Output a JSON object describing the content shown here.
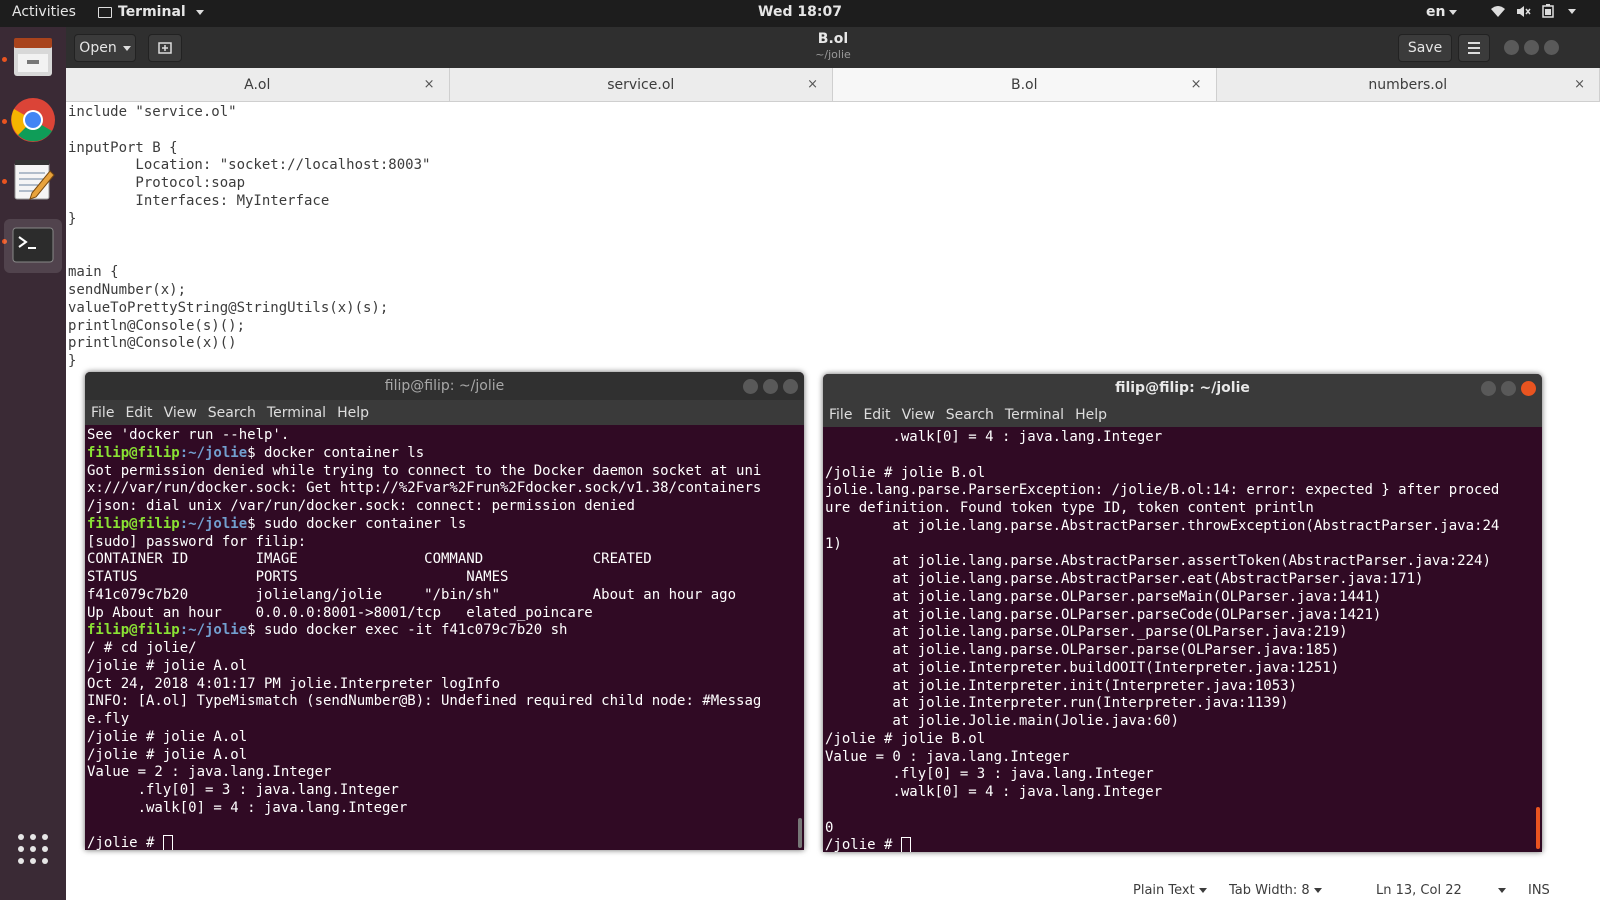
{
  "topbar": {
    "activities": "Activities",
    "app_name": "Terminal",
    "clock": "Wed 18:07",
    "lang": "en"
  },
  "dock": {
    "items": [
      {
        "name": "files",
        "color": "#e6e6e6"
      },
      {
        "name": "chrome",
        "color": "#4285f4"
      },
      {
        "name": "text-editor",
        "color": "#f5f5f5"
      },
      {
        "name": "terminal",
        "color": "#2c2c2c"
      }
    ]
  },
  "gedit": {
    "open_label": "Open",
    "title": "B.ol",
    "subtitle": "~/jolie",
    "save_label": "Save",
    "tabs": [
      {
        "label": "A.ol",
        "close": "×"
      },
      {
        "label": "service.ol",
        "close": "×"
      },
      {
        "label": "B.ol",
        "close": "×"
      },
      {
        "label": "numbers.ol",
        "close": "×"
      }
    ],
    "editor_lines": [
      "include \"service.ol\"",
      "",
      "inputPort B {",
      "        Location: \"socket://localhost:8003\"",
      "        Protocol:soap",
      "        Interfaces: MyInterface",
      "}",
      "",
      "",
      "main {",
      "sendNumber(x);",
      "valueToPrettyString@StringUtils(x)(s);",
      "println@Console(s)();",
      "println@Console(x)()",
      "}"
    ],
    "status": {
      "language": "Plain Text",
      "tab_width": "Tab Width: 8",
      "position": "Ln 13, Col 22",
      "mode": "INS"
    }
  },
  "term_left": {
    "title": "filip@filip: ~/jolie",
    "menu": [
      "File",
      "Edit",
      "View",
      "Search",
      "Terminal",
      "Help"
    ],
    "lines": [
      {
        "t": "See 'docker run --help'."
      },
      {
        "user": "filip@filip",
        "path": ":~/jolie",
        "t": "$ docker container ls"
      },
      {
        "t": "Got permission denied while trying to connect to the Docker daemon socket at uni"
      },
      {
        "t": "x:///var/run/docker.sock: Get http://%2Fvar%2Frun%2Fdocker.sock/v1.38/containers"
      },
      {
        "t": "/json: dial unix /var/run/docker.sock: connect: permission denied"
      },
      {
        "user": "filip@filip",
        "path": ":~/jolie",
        "t": "$ sudo docker container ls"
      },
      {
        "t": "[sudo] password for filip:"
      },
      {
        "t": "CONTAINER ID        IMAGE               COMMAND             CREATED"
      },
      {
        "t": "STATUS              PORTS                    NAMES"
      },
      {
        "t": "f41c079c7b20        jolielang/jolie     \"/bin/sh\"           About an hour ago"
      },
      {
        "t": "Up About an hour    0.0.0.0:8001->8001/tcp   elated_poincare"
      },
      {
        "user": "filip@filip",
        "path": ":~/jolie",
        "t": "$ sudo docker exec -it f41c079c7b20 sh"
      },
      {
        "t": "/ # cd jolie/"
      },
      {
        "t": "/jolie # jolie A.ol"
      },
      {
        "t": "Oct 24, 2018 4:01:17 PM jolie.Interpreter logInfo"
      },
      {
        "t": "INFO: [A.ol] TypeMismatch (sendNumber@B): Undefined required child node: #Messag"
      },
      {
        "t": "e.fly"
      },
      {
        "t": "/jolie # jolie A.ol"
      },
      {
        "t": "/jolie # jolie A.ol"
      },
      {
        "t": "Value = 2 : java.lang.Integer"
      },
      {
        "t": "      .fly[0] = 3 : java.lang.Integer"
      },
      {
        "t": "      .walk[0] = 4 : java.lang.Integer"
      },
      {
        "t": ""
      },
      {
        "t": "/jolie # ",
        "cursor": true
      }
    ]
  },
  "term_right": {
    "title": "filip@filip: ~/jolie",
    "menu": [
      "File",
      "Edit",
      "View",
      "Search",
      "Terminal",
      "Help"
    ],
    "lines": [
      {
        "t": "        .walk[0] = 4 : java.lang.Integer"
      },
      {
        "t": ""
      },
      {
        "t": "/jolie # jolie B.ol"
      },
      {
        "t": "jolie.lang.parse.ParserException: /jolie/B.ol:14: error: expected } after proced"
      },
      {
        "t": "ure definition. Found token type ID, token content println"
      },
      {
        "t": "        at jolie.lang.parse.AbstractParser.throwException(AbstractParser.java:24"
      },
      {
        "t": "1)"
      },
      {
        "t": "        at jolie.lang.parse.AbstractParser.assertToken(AbstractParser.java:224)"
      },
      {
        "t": "        at jolie.lang.parse.AbstractParser.eat(AbstractParser.java:171)"
      },
      {
        "t": "        at jolie.lang.parse.OLParser.parseMain(OLParser.java:1441)"
      },
      {
        "t": "        at jolie.lang.parse.OLParser.parseCode(OLParser.java:1421)"
      },
      {
        "t": "        at jolie.lang.parse.OLParser._parse(OLParser.java:219)"
      },
      {
        "t": "        at jolie.lang.parse.OLParser.parse(OLParser.java:185)"
      },
      {
        "t": "        at jolie.Interpreter.buildOOIT(Interpreter.java:1251)"
      },
      {
        "t": "        at jolie.Interpreter.init(Interpreter.java:1053)"
      },
      {
        "t": "        at jolie.Interpreter.run(Interpreter.java:1139)"
      },
      {
        "t": "        at jolie.Jolie.main(Jolie.java:60)"
      },
      {
        "t": "/jolie # jolie B.ol"
      },
      {
        "t": "Value = 0 : java.lang.Integer"
      },
      {
        "t": "        .fly[0] = 3 : java.lang.Integer"
      },
      {
        "t": "        .walk[0] = 4 : java.lang.Integer"
      },
      {
        "t": ""
      },
      {
        "t": "0"
      },
      {
        "t": "/jolie # ",
        "cursor": true
      }
    ]
  }
}
